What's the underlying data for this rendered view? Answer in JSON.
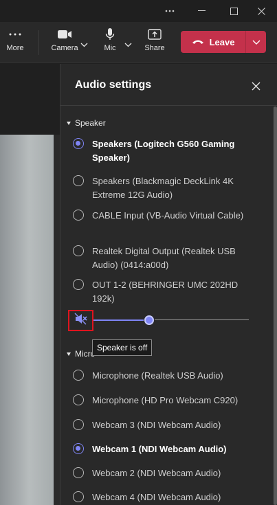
{
  "titlebar": {
    "buttons": [
      "more",
      "minimize",
      "maximize",
      "close"
    ]
  },
  "toolbar": {
    "more_label": "More",
    "camera_label": "Camera",
    "mic_label": "Mic",
    "share_label": "Share",
    "leave_label": "Leave",
    "leave_color": "#c4314b"
  },
  "panel": {
    "title": "Audio settings",
    "speaker_section": "Speaker",
    "speakers": [
      {
        "label": "Speakers (Logitech G560 Gaming Speaker)",
        "selected": true
      },
      {
        "label": "Speakers (Blackmagic DeckLink 4K Extreme 12G Audio)",
        "selected": false
      },
      {
        "label": "CABLE Input (VB-Audio Virtual Cable)",
        "selected": false
      },
      {
        "label": "Realtek Digital Output (Realtek USB Audio) (0414:a00d)",
        "selected": false
      },
      {
        "label": "OUT 1-2 (BEHRINGER UMC 202HD 192k)",
        "selected": false
      }
    ],
    "speaker_volume": 0.36,
    "speaker_muted": true,
    "tooltip": "Speaker is off",
    "mic_section": "Micro",
    "microphones": [
      {
        "label": "Microphone (Realtek USB  Audio)",
        "selected": false
      },
      {
        "label": "Microphone (HD Pro Webcam C920)",
        "selected": false
      },
      {
        "label": "Webcam 3 (NDI Webcam Audio)",
        "selected": false
      },
      {
        "label": "Webcam 1 (NDI Webcam Audio)",
        "selected": true
      },
      {
        "label": "Webcam 2 (NDI Webcam Audio)",
        "selected": false
      },
      {
        "label": "Webcam 4 (NDI Webcam Audio)",
        "selected": false
      }
    ],
    "accent_color": "#7f85f5",
    "highlight_color": "#e0141e"
  }
}
